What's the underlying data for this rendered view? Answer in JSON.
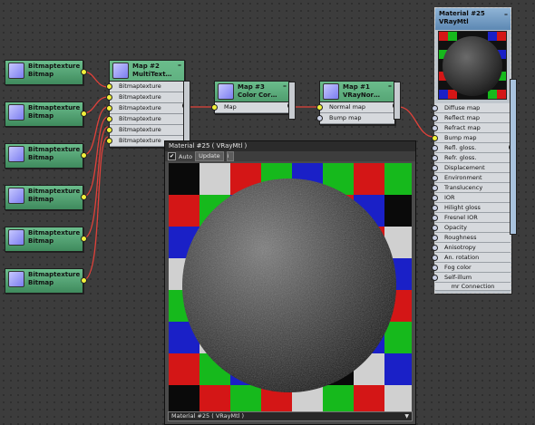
{
  "bitmap_nodes": [
    {
      "title": "Bitmaptexture",
      "subtitle": "Bitmap"
    },
    {
      "title": "Bitmaptexture",
      "subtitle": "Bitmap"
    },
    {
      "title": "Bitmaptexture",
      "subtitle": "Bitmap"
    },
    {
      "title": "Bitmaptexture",
      "subtitle": "Bitmap"
    },
    {
      "title": "Bitmaptexture",
      "subtitle": "Bitmap"
    },
    {
      "title": "Bitmaptexture",
      "subtitle": "Bitmap"
    }
  ],
  "multitexture_node": {
    "title": "Map #2",
    "subtitle": "MultiText…",
    "slots": [
      "Bitmaptexture",
      "Bitmaptexture",
      "Bitmaptexture",
      "Bitmaptexture",
      "Bitmaptexture",
      "Bitmaptexture"
    ]
  },
  "color_correction_node": {
    "title": "Map #3",
    "subtitle": "Color Cor…",
    "slots": [
      "Map"
    ]
  },
  "normal_node": {
    "title": "Map #1",
    "subtitle": "VRayNor…",
    "slots": [
      "Normal map",
      "Bump map"
    ]
  },
  "material_node": {
    "title": "Material #25",
    "subtitle": "VRayMtl",
    "slots": [
      "Diffuse map",
      "Reflect map",
      "Refract map",
      "Bump map",
      "Refl. gloss.",
      "Refr. gloss.",
      "Displacement",
      "Environment",
      "Translucency",
      "IOR",
      "Hilight gloss",
      "Fresnel IOR",
      "Opacity",
      "Roughness",
      "Anisotropy",
      "An. rotation",
      "Fog color",
      "Self-illum",
      "mr Connection"
    ]
  },
  "preview_window": {
    "title": "Material #25  ( VRayMtl )",
    "auto_label": "Auto",
    "auto_checked": "✔",
    "update_label": "Update",
    "selector_value": "Material #25  ( VRayMtl )"
  },
  "colors": {
    "node_green": "#5aa97a",
    "wire": "#e0413a",
    "material_header": "#7aa3cc",
    "checker": [
      "#d41616",
      "#16b91c",
      "#1a20c7",
      "#d0d0d0",
      "#0a0a0a"
    ]
  }
}
